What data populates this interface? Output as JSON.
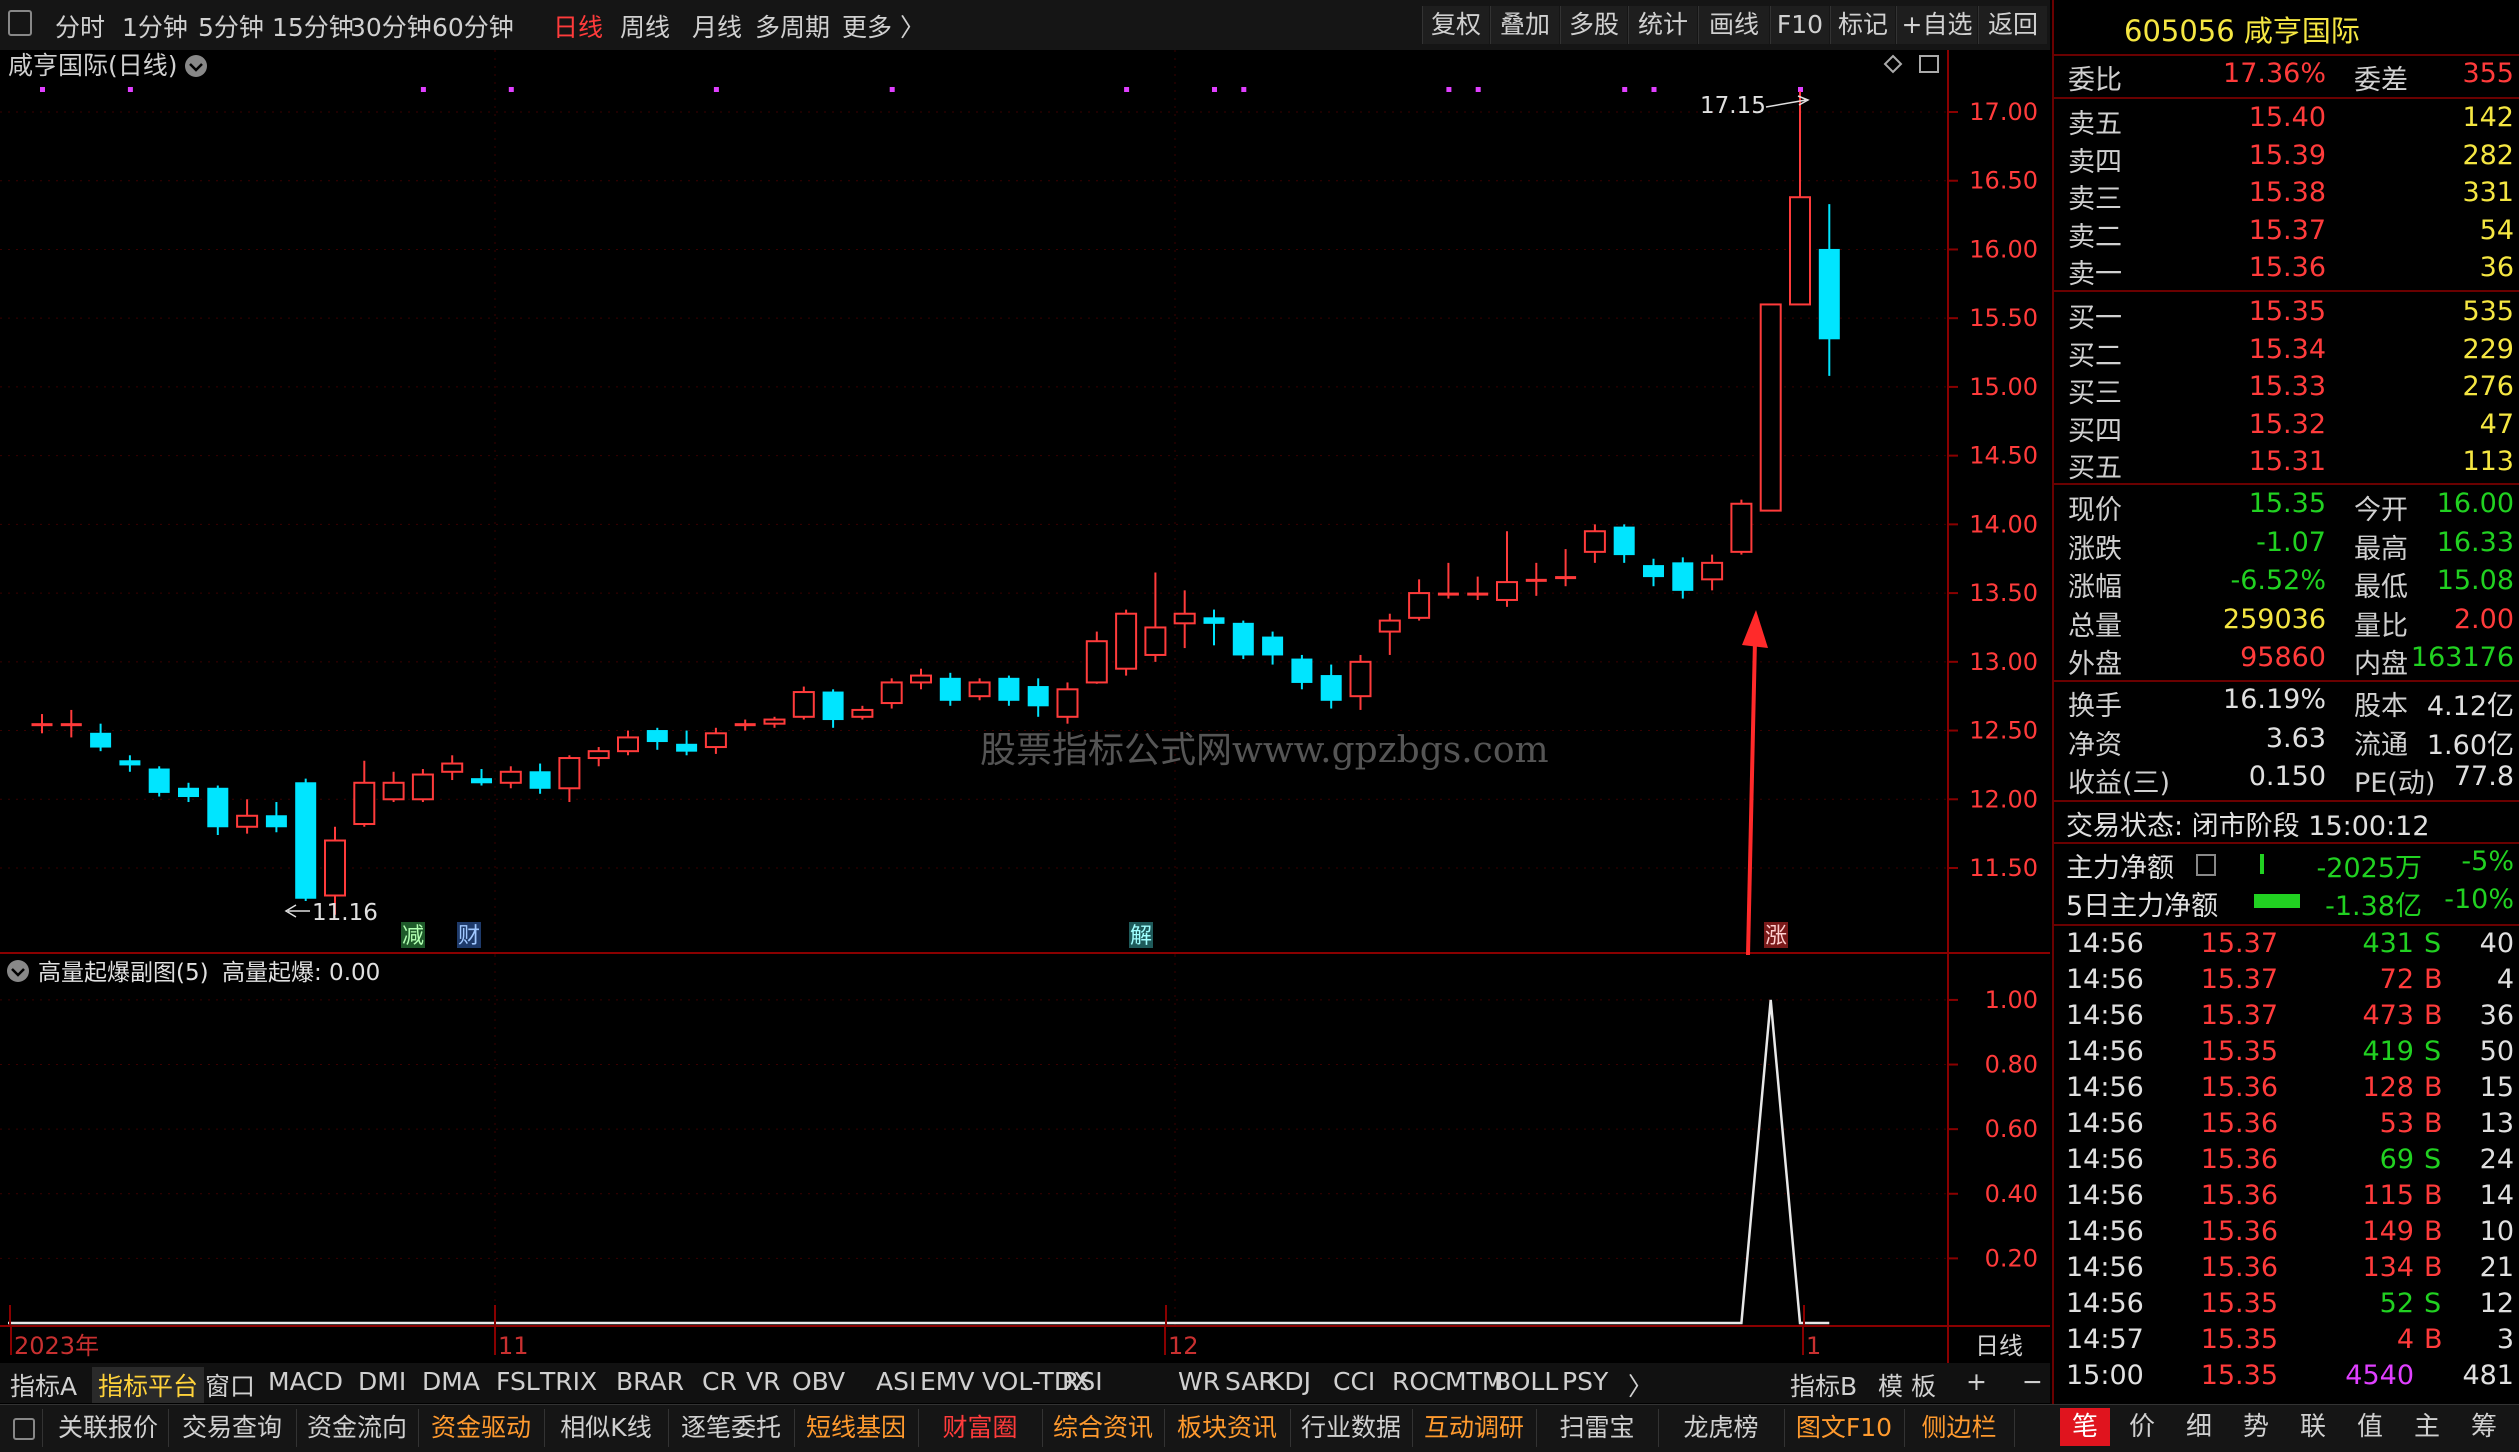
{
  "toolbar": {
    "periods": [
      "分时",
      "1分钟",
      "5分钟",
      "15分钟",
      "30分钟",
      "60分钟",
      "日线",
      "周线",
      "月线",
      "多周期",
      "更多 〉"
    ],
    "active_period": "日线",
    "right_buttons": [
      "复权",
      "叠加",
      "多股",
      "统计",
      "画线",
      "F10",
      "标记",
      "+自选",
      "返回"
    ]
  },
  "chart": {
    "title": "咸亨国际(日线)",
    "high_label": "17.15",
    "low_label": "11.16",
    "watermark": "股票指标公式网www.gpzbgs.com",
    "event_tags": [
      "减",
      "财",
      "解",
      "涨"
    ],
    "x_labels": [
      "2023年",
      "11",
      "12",
      "1"
    ],
    "period_label": "日线",
    "sub_title": "高量起爆副图(5)",
    "sub_value_label": "高量起爆: 0.00"
  },
  "chart_data": [
    {
      "type": "candlestick",
      "title": "咸亨国际(日线)",
      "y_ticks": [
        "17.00",
        "16.50",
        "16.00",
        "15.50",
        "15.00",
        "14.50",
        "14.00",
        "13.50",
        "13.00",
        "12.50",
        "12.00",
        "11.50"
      ],
      "ylim": [
        11.2,
        17.15
      ],
      "candles": [
        {
          "o": 12.55,
          "c": 12.55,
          "h": 12.62,
          "l": 12.48
        },
        {
          "o": 12.55,
          "c": 12.55,
          "h": 12.65,
          "l": 12.45
        },
        {
          "o": 12.48,
          "c": 12.38,
          "h": 12.55,
          "l": 12.35
        },
        {
          "o": 12.28,
          "c": 12.25,
          "h": 12.32,
          "l": 12.2
        },
        {
          "o": 12.22,
          "c": 12.05,
          "h": 12.24,
          "l": 12.02
        },
        {
          "o": 12.08,
          "c": 12.02,
          "h": 12.12,
          "l": 11.98
        },
        {
          "o": 12.08,
          "c": 11.8,
          "h": 12.1,
          "l": 11.74
        },
        {
          "o": 11.8,
          "c": 11.88,
          "h": 12.0,
          "l": 11.75
        },
        {
          "o": 11.88,
          "c": 11.8,
          "h": 11.98,
          "l": 11.76
        },
        {
          "o": 12.12,
          "c": 11.28,
          "h": 12.15,
          "l": 11.26
        },
        {
          "o": 11.3,
          "c": 11.7,
          "h": 11.8,
          "l": 11.16
        },
        {
          "o": 11.82,
          "c": 12.12,
          "h": 12.28,
          "l": 11.8
        },
        {
          "o": 12.0,
          "c": 12.12,
          "h": 12.2,
          "l": 11.98
        },
        {
          "o": 12.0,
          "c": 12.18,
          "h": 12.22,
          "l": 11.98
        },
        {
          "o": 12.2,
          "c": 12.26,
          "h": 12.32,
          "l": 12.14
        },
        {
          "o": 12.15,
          "c": 12.12,
          "h": 12.22,
          "l": 12.1
        },
        {
          "o": 12.12,
          "c": 12.2,
          "h": 12.24,
          "l": 12.08
        },
        {
          "o": 12.2,
          "c": 12.08,
          "h": 12.26,
          "l": 12.04
        },
        {
          "o": 12.08,
          "c": 12.3,
          "h": 12.32,
          "l": 11.98
        },
        {
          "o": 12.3,
          "c": 12.35,
          "h": 12.38,
          "l": 12.24
        },
        {
          "o": 12.35,
          "c": 12.45,
          "h": 12.5,
          "l": 12.32
        },
        {
          "o": 12.5,
          "c": 12.42,
          "h": 12.52,
          "l": 12.36
        },
        {
          "o": 12.4,
          "c": 12.35,
          "h": 12.5,
          "l": 12.32
        },
        {
          "o": 12.38,
          "c": 12.48,
          "h": 12.52,
          "l": 12.33
        },
        {
          "o": 12.55,
          "c": 12.55,
          "h": 12.58,
          "l": 12.5
        },
        {
          "o": 12.55,
          "c": 12.58,
          "h": 12.6,
          "l": 12.52
        },
        {
          "o": 12.6,
          "c": 12.78,
          "h": 12.82,
          "l": 12.58
        },
        {
          "o": 12.78,
          "c": 12.58,
          "h": 12.8,
          "l": 12.52
        },
        {
          "o": 12.6,
          "c": 12.65,
          "h": 12.68,
          "l": 12.58
        },
        {
          "o": 12.7,
          "c": 12.85,
          "h": 12.88,
          "l": 12.66
        },
        {
          "o": 12.85,
          "c": 12.9,
          "h": 12.95,
          "l": 12.8
        },
        {
          "o": 12.88,
          "c": 12.72,
          "h": 12.92,
          "l": 12.68
        },
        {
          "o": 12.75,
          "c": 12.85,
          "h": 12.88,
          "l": 12.72
        },
        {
          "o": 12.88,
          "c": 12.72,
          "h": 12.9,
          "l": 12.68
        },
        {
          "o": 12.82,
          "c": 12.68,
          "h": 12.88,
          "l": 12.6
        },
        {
          "o": 12.6,
          "c": 12.8,
          "h": 12.85,
          "l": 12.55
        },
        {
          "o": 12.85,
          "c": 13.15,
          "h": 13.22,
          "l": 12.84
        },
        {
          "o": 12.95,
          "c": 13.35,
          "h": 13.38,
          "l": 12.9
        },
        {
          "o": 13.05,
          "c": 13.25,
          "h": 13.65,
          "l": 13.0
        },
        {
          "o": 13.28,
          "c": 13.35,
          "h": 13.52,
          "l": 13.1
        },
        {
          "o": 13.32,
          "c": 13.28,
          "h": 13.38,
          "l": 13.12
        },
        {
          "o": 13.28,
          "c": 13.05,
          "h": 13.3,
          "l": 13.02
        },
        {
          "o": 13.18,
          "c": 13.05,
          "h": 13.22,
          "l": 12.98
        },
        {
          "o": 13.02,
          "c": 12.85,
          "h": 13.05,
          "l": 12.8
        },
        {
          "o": 12.9,
          "c": 12.72,
          "h": 12.98,
          "l": 12.66
        },
        {
          "o": 12.75,
          "c": 13.0,
          "h": 13.05,
          "l": 12.65
        },
        {
          "o": 13.22,
          "c": 13.3,
          "h": 13.35,
          "l": 13.05
        },
        {
          "o": 13.32,
          "c": 13.5,
          "h": 13.6,
          "l": 13.3
        },
        {
          "o": 13.5,
          "c": 13.5,
          "h": 13.72,
          "l": 13.46
        },
        {
          "o": 13.5,
          "c": 13.5,
          "h": 13.62,
          "l": 13.45
        },
        {
          "o": 13.45,
          "c": 13.58,
          "h": 13.95,
          "l": 13.4
        },
        {
          "o": 13.6,
          "c": 13.6,
          "h": 13.72,
          "l": 13.48
        },
        {
          "o": 13.62,
          "c": 13.62,
          "h": 13.82,
          "l": 13.55
        },
        {
          "o": 13.8,
          "c": 13.95,
          "h": 14.0,
          "l": 13.72
        },
        {
          "o": 13.98,
          "c": 13.78,
          "h": 14.0,
          "l": 13.72
        },
        {
          "o": 13.7,
          "c": 13.62,
          "h": 13.75,
          "l": 13.55
        },
        {
          "o": 13.72,
          "c": 13.52,
          "h": 13.76,
          "l": 13.46
        },
        {
          "o": 13.6,
          "c": 13.72,
          "h": 13.78,
          "l": 13.52
        },
        {
          "o": 13.8,
          "c": 14.15,
          "h": 14.18,
          "l": 13.78
        },
        {
          "o": 14.1,
          "c": 15.6,
          "h": 15.6,
          "l": 14.1
        },
        {
          "o": 15.6,
          "c": 16.38,
          "h": 17.15,
          "l": 15.65
        },
        {
          "o": 16.0,
          "c": 15.35,
          "h": 16.33,
          "l": 15.08
        }
      ]
    },
    {
      "type": "line",
      "title": "高量起爆副图(5)",
      "y_ticks": [
        "1.00",
        "0.80",
        "0.60",
        "0.40",
        "0.20"
      ],
      "ylim": [
        0,
        1.1
      ],
      "series": [
        {
          "name": "高量起爆",
          "values": [
            0,
            0,
            0,
            0,
            0,
            0,
            0,
            0,
            0,
            0,
            0,
            0,
            0,
            0,
            0,
            0,
            0,
            0,
            0,
            0,
            0,
            0,
            0,
            0,
            0,
            0,
            0,
            0,
            0,
            0,
            0,
            0,
            0,
            0,
            0,
            0,
            0,
            0,
            0,
            0,
            0,
            0,
            0,
            0,
            0,
            0,
            0,
            0,
            0,
            0,
            0,
            0,
            0,
            0,
            0,
            0,
            0,
            0,
            0,
            1,
            0,
            0
          ]
        }
      ]
    }
  ],
  "quote": {
    "code_name": "605056 咸亨国际",
    "ratio_label": "委比",
    "ratio_value": "17.36%",
    "diff_label": "委差",
    "diff_value": "355",
    "asks": [
      {
        "label": "卖五",
        "price": "15.40",
        "vol": "142"
      },
      {
        "label": "卖四",
        "price": "15.39",
        "vol": "282"
      },
      {
        "label": "卖三",
        "price": "15.38",
        "vol": "331"
      },
      {
        "label": "卖二",
        "price": "15.37",
        "vol": "54"
      },
      {
        "label": "卖一",
        "price": "15.36",
        "vol": "36"
      }
    ],
    "bids": [
      {
        "label": "买一",
        "price": "15.35",
        "vol": "535"
      },
      {
        "label": "买二",
        "price": "15.34",
        "vol": "229"
      },
      {
        "label": "买三",
        "price": "15.33",
        "vol": "276"
      },
      {
        "label": "买四",
        "price": "15.32",
        "vol": "47"
      },
      {
        "label": "买五",
        "price": "15.31",
        "vol": "113"
      }
    ],
    "stats1": [
      {
        "l1": "现价",
        "v1": "15.35",
        "c1": "grn",
        "l2": "今开",
        "v2": "16.00",
        "c2": "grn"
      },
      {
        "l1": "涨跌",
        "v1": "-1.07",
        "c1": "grn",
        "l2": "最高",
        "v2": "16.33",
        "c2": "grn"
      },
      {
        "l1": "涨幅",
        "v1": "-6.52%",
        "c1": "grn",
        "l2": "最低",
        "v2": "15.08",
        "c2": "grn"
      },
      {
        "l1": "总量",
        "v1": "259036",
        "c1": "yel",
        "l2": "量比",
        "v2": "2.00",
        "c2": "red"
      },
      {
        "l1": "外盘",
        "v1": "95860",
        "c1": "red",
        "l2": "内盘",
        "v2": "163176",
        "c2": "grn"
      }
    ],
    "stats2": [
      {
        "l1": "换手",
        "v1": "16.19%",
        "l2": "股本",
        "v2": "4.12亿"
      },
      {
        "l1": "净资",
        "v1": "3.63",
        "l2": "流通",
        "v2": "1.60亿"
      },
      {
        "l1": "收益(三)",
        "v1": "0.150",
        "l2": "PE(动)",
        "v2": "77.8"
      }
    ],
    "trade_status": "交易状态: 闭市阶段 15:00:12",
    "main_net_label": "主力净额",
    "main_net_value": "-2025万",
    "main_net_pct": "-5%",
    "five_day_label": "5日主力净额",
    "five_day_value": "-1.38亿",
    "five_day_pct": "-10%"
  },
  "ticks": [
    {
      "t": "14:56",
      "p": "15.37",
      "v": "431",
      "bs": "S",
      "n": "40"
    },
    {
      "t": "14:56",
      "p": "15.37",
      "v": "72",
      "bs": "B",
      "n": "4"
    },
    {
      "t": "14:56",
      "p": "15.37",
      "v": "473",
      "bs": "B",
      "n": "36"
    },
    {
      "t": "14:56",
      "p": "15.35",
      "v": "419",
      "bs": "S",
      "n": "50"
    },
    {
      "t": "14:56",
      "p": "15.36",
      "v": "128",
      "bs": "B",
      "n": "15"
    },
    {
      "t": "14:56",
      "p": "15.36",
      "v": "53",
      "bs": "B",
      "n": "13"
    },
    {
      "t": "14:56",
      "p": "15.36",
      "v": "69",
      "bs": "S",
      "n": "24"
    },
    {
      "t": "14:56",
      "p": "15.36",
      "v": "115",
      "bs": "B",
      "n": "14"
    },
    {
      "t": "14:56",
      "p": "15.36",
      "v": "149",
      "bs": "B",
      "n": "10"
    },
    {
      "t": "14:56",
      "p": "15.36",
      "v": "134",
      "bs": "B",
      "n": "21"
    },
    {
      "t": "14:56",
      "p": "15.35",
      "v": "52",
      "bs": "S",
      "n": "12"
    },
    {
      "t": "14:57",
      "p": "15.35",
      "v": "4",
      "bs": "B",
      "n": "3"
    },
    {
      "t": "15:00",
      "p": "15.35",
      "v": "4540",
      "bs": "",
      "n": "481"
    }
  ],
  "indicator_tabs": [
    "指标A",
    "指标平台",
    "窗口",
    "MACD",
    "DMI",
    "DMA",
    "FSL",
    "TRIX",
    "BRAR",
    "CR",
    "VR",
    "OBV",
    "ASI",
    "EMV",
    "VOL-TDX",
    "RSI",
    "WR",
    "SAR",
    "KDJ",
    "CCI",
    "ROC",
    "MTM",
    "BOLL",
    "PSY",
    "〉"
  ],
  "indicator_right": [
    "指标B",
    "模 板",
    "+",
    "−"
  ],
  "function_tabs": [
    "关联报价",
    "交易查询",
    "资金流向",
    "资金驱动",
    "相似K线",
    "逐笔委托",
    "短线基因",
    "财富圈",
    "综合资讯",
    "板块资讯",
    "行业数据",
    "互动调研",
    "扫雷宝",
    "龙虎榜",
    "图文F10",
    "侧边栏"
  ],
  "right_tabs": [
    "笔",
    "价",
    "细",
    "势",
    "联",
    "值",
    "主",
    "筹"
  ],
  "colors": {
    "up": "#ff3b3b",
    "down": "#00e5ff",
    "bg": "#000000",
    "grid": "#6a0000",
    "green": "#21d121",
    "magenta": "#e040ff"
  }
}
